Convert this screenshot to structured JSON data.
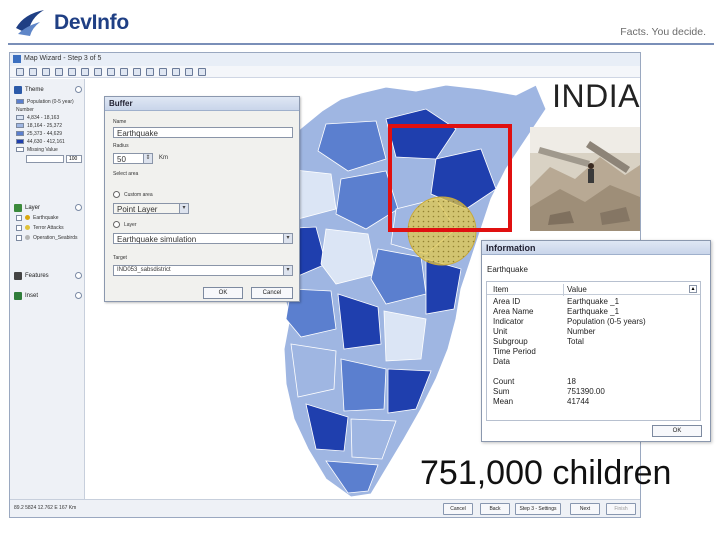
{
  "brand": {
    "name": "DevInfo",
    "tagline": "Facts. You decide."
  },
  "window": {
    "title": "Map Wizard - Step 3 of 5",
    "status_text": "89.2 5824  12.762 E  167 Km",
    "buttons": {
      "cancel": "Cancel",
      "back": "Back",
      "step": "Step 3 - Settings",
      "next": "Next",
      "finish": "Finish"
    }
  },
  "left_panel": {
    "theme_label": "Theme",
    "theme_subtitle": "Population (0-5 year)",
    "legend_title": "Number",
    "legend": [
      {
        "range": "4,834 - 18,163",
        "color": "#dbe5f5"
      },
      {
        "range": "18,164 - 25,372",
        "color": "#9fb6e2"
      },
      {
        "range": "25,373 - 44,629",
        "color": "#5b7fcf"
      },
      {
        "range": "44,630 - 412,161",
        "color": "#1f3fae"
      },
      {
        "range": "Missing Value",
        "color": "#ffffff"
      }
    ],
    "opacity_value": "100",
    "layer_label": "Layer",
    "layers": [
      "Earthquake",
      "Terror Attacks",
      "Operation_Seabirds"
    ],
    "features_label": "Features",
    "inset_label": "Inset"
  },
  "buffer_dialog": {
    "title": "Buffer",
    "name_label": "Name",
    "name_value": "Earthquake",
    "radius_label": "Radius",
    "radius_value": "50",
    "radius_unit": "Km",
    "select_label": "Select area",
    "option_custom": "Custom area",
    "layer_value": "Point Layer",
    "option_layer": "Layer",
    "layer_name_value": "Earthquake simulation",
    "target_label": "Target",
    "target_value": "IND053_sabsdistrict",
    "ok": "OK",
    "cancel": "Cancel"
  },
  "info_panel": {
    "title": "Information",
    "subtitle": "Earthquake",
    "col_item": "Item",
    "col_value": "Value",
    "rows": [
      {
        "item": "Area ID",
        "value": "Earthquake _1"
      },
      {
        "item": "Area Name",
        "value": "Earthquake _1"
      },
      {
        "item": "Indicator",
        "value": "Population (0-5 years)"
      },
      {
        "item": "Unit",
        "value": "Number"
      },
      {
        "item": "Subgroup",
        "value": "Total"
      },
      {
        "item": "Time Period",
        "value": ""
      },
      {
        "item": "Data",
        "value": ""
      },
      {
        "item": "Count",
        "value": "18"
      },
      {
        "item": "Sum",
        "value": "751390.00"
      },
      {
        "item": "Mean",
        "value": "41744"
      }
    ],
    "ok": "OK"
  },
  "overlay": {
    "country": "INDIA",
    "children": "751,000 children"
  },
  "colors": {
    "brand": "#1f3f84",
    "highlight_box": "#e01010",
    "buffer_circle": "#e3c84a",
    "map_dark": "#1f3fae",
    "map_light": "#dbe5f5"
  }
}
